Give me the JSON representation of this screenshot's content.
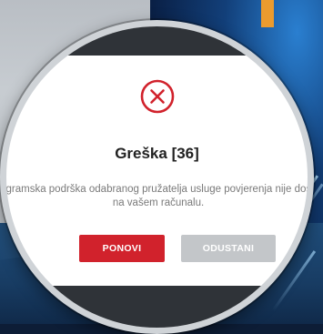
{
  "dialog": {
    "title": "Greška [36]",
    "message_line1": "rogramska podrška odabranog pružatelja usluge povjerenja nije dostu",
    "message_line2": "na vašem računalu.",
    "retry_label": "PONOVI",
    "cancel_label": "ODUSTANI",
    "icon": "error-circle-x-icon"
  },
  "colors": {
    "accent_red": "#d1222c",
    "button_gray": "#c3c6c9",
    "title_text": "#222222",
    "message_text": "#7a7a7a"
  }
}
